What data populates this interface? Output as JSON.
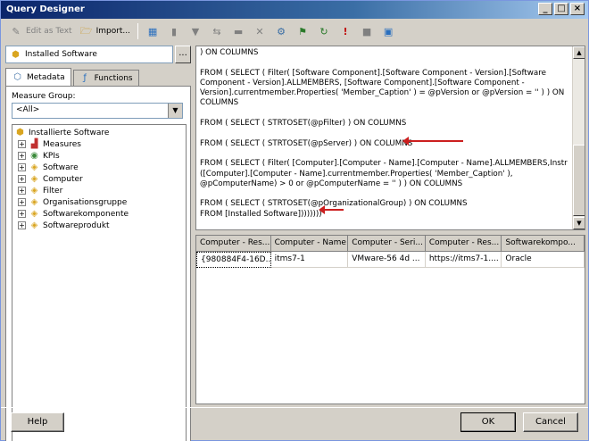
{
  "window": {
    "title": "Query Designer"
  },
  "toolbar": {
    "edit_as_text": "Edit as Text",
    "import": "Import..."
  },
  "left": {
    "cube": "Installed Software",
    "browse": "...",
    "tabs": [
      {
        "label": "Metadata"
      },
      {
        "label": "Functions"
      }
    ],
    "measure_group_label": "Measure Group:",
    "measure_group_value": "<All>",
    "tree_root": "Installierte Software",
    "tree_items": [
      {
        "label": "Measures"
      },
      {
        "label": "KPIs"
      },
      {
        "label": "Software"
      },
      {
        "label": "Computer"
      },
      {
        "label": "Filter"
      },
      {
        "label": "Organisationsgruppe"
      },
      {
        "label": "Softwarekomponente"
      },
      {
        "label": "Softwareprodukt"
      }
    ]
  },
  "query": {
    "lines": [
      ") ON COLUMNS",
      "FROM ( SELECT ( Filter( [Software Component].[Software Component - Version].[Software Component - Version].ALLMEMBERS, [Software Component].[Software Component - Version].currentmember.Properties( 'Member_Caption' ) = @pVersion or @pVersion = '' ) ) ON COLUMNS",
      "FROM ( SELECT ( STRTOSET(@pFilter) ) ON COLUMNS",
      "FROM ( SELECT ( STRTOSET(@pServer) ) ON COLUMNS",
      "FROM ( SELECT ( Filter( [Computer].[Computer - Name].[Computer - Name].ALLMEMBERS,Instr ([Computer].[Computer - Name].currentmember.Properties( 'Member_Caption' ), @pComputerName) > 0 or @pComputerName = '' ) ) ON COLUMNS",
      "FROM ( SELECT ( STRTOSET(@pOrganizationalGroup) ) ON COLUMNS",
      "FROM [Installed Software])))))))"
    ]
  },
  "results": {
    "columns": [
      "Computer - Res...",
      "Computer - Name",
      "Computer - Seri...",
      "Computer - Res...",
      "Softwarekompo..."
    ],
    "rows": [
      [
        "{980884F4-16D...",
        "itms7-1",
        "VMware-56 4d ...",
        "https://itms7-1....",
        "Oracle"
      ]
    ]
  },
  "buttons": {
    "help": "Help",
    "ok": "OK",
    "cancel": "Cancel"
  },
  "colors": {
    "arrow": "#cc1f1f",
    "title_start": "#0a246a"
  }
}
